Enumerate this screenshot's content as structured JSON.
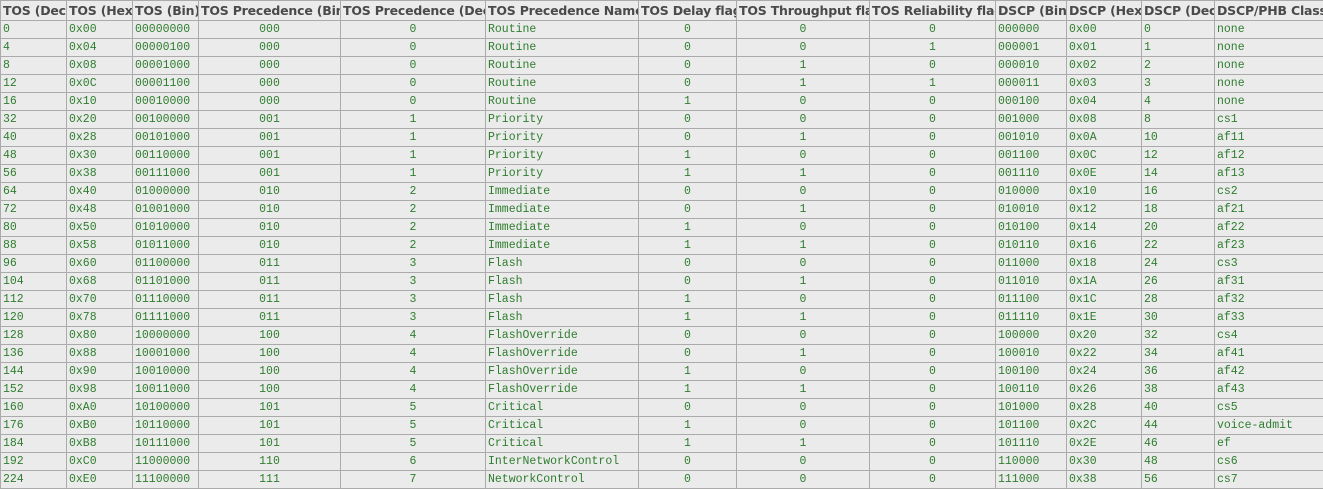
{
  "table": {
    "headers": [
      "TOS (Dec)",
      "TOS (Hex)",
      "TOS (Bin)",
      "TOS Precedence (Bin)",
      "TOS Precedence (Dec)",
      "TOS Precedence Name",
      "TOS Delay flag",
      "TOS Throughput flag",
      "TOS Reliability flag",
      "DSCP (Bin)",
      "DSCP (Hex)",
      "DSCP (Dec)",
      "DSCP/PHB Class"
    ],
    "rows": [
      [
        "0",
        "0x00",
        "00000000",
        "000",
        "0",
        "Routine",
        "0",
        "0",
        "0",
        "000000",
        "0x00",
        "0",
        "none"
      ],
      [
        "4",
        "0x04",
        "00000100",
        "000",
        "0",
        "Routine",
        "0",
        "0",
        "1",
        "000001",
        "0x01",
        "1",
        "none"
      ],
      [
        "8",
        "0x08",
        "00001000",
        "000",
        "0",
        "Routine",
        "0",
        "1",
        "0",
        "000010",
        "0x02",
        "2",
        "none"
      ],
      [
        "12",
        "0x0C",
        "00001100",
        "000",
        "0",
        "Routine",
        "0",
        "1",
        "1",
        "000011",
        "0x03",
        "3",
        "none"
      ],
      [
        "16",
        "0x10",
        "00010000",
        "000",
        "0",
        "Routine",
        "1",
        "0",
        "0",
        "000100",
        "0x04",
        "4",
        "none"
      ],
      [
        "32",
        "0x20",
        "00100000",
        "001",
        "1",
        "Priority",
        "0",
        "0",
        "0",
        "001000",
        "0x08",
        "8",
        "cs1"
      ],
      [
        "40",
        "0x28",
        "00101000",
        "001",
        "1",
        "Priority",
        "0",
        "1",
        "0",
        "001010",
        "0x0A",
        "10",
        "af11"
      ],
      [
        "48",
        "0x30",
        "00110000",
        "001",
        "1",
        "Priority",
        "1",
        "0",
        "0",
        "001100",
        "0x0C",
        "12",
        "af12"
      ],
      [
        "56",
        "0x38",
        "00111000",
        "001",
        "1",
        "Priority",
        "1",
        "1",
        "0",
        "001110",
        "0x0E",
        "14",
        "af13"
      ],
      [
        "64",
        "0x40",
        "01000000",
        "010",
        "2",
        "Immediate",
        "0",
        "0",
        "0",
        "010000",
        "0x10",
        "16",
        "cs2"
      ],
      [
        "72",
        "0x48",
        "01001000",
        "010",
        "2",
        "Immediate",
        "0",
        "1",
        "0",
        "010010",
        "0x12",
        "18",
        "af21"
      ],
      [
        "80",
        "0x50",
        "01010000",
        "010",
        "2",
        "Immediate",
        "1",
        "0",
        "0",
        "010100",
        "0x14",
        "20",
        "af22"
      ],
      [
        "88",
        "0x58",
        "01011000",
        "010",
        "2",
        "Immediate",
        "1",
        "1",
        "0",
        "010110",
        "0x16",
        "22",
        "af23"
      ],
      [
        "96",
        "0x60",
        "01100000",
        "011",
        "3",
        "Flash",
        "0",
        "0",
        "0",
        "011000",
        "0x18",
        "24",
        "cs3"
      ],
      [
        "104",
        "0x68",
        "01101000",
        "011",
        "3",
        "Flash",
        "0",
        "1",
        "0",
        "011010",
        "0x1A",
        "26",
        "af31"
      ],
      [
        "112",
        "0x70",
        "01110000",
        "011",
        "3",
        "Flash",
        "1",
        "0",
        "0",
        "011100",
        "0x1C",
        "28",
        "af32"
      ],
      [
        "120",
        "0x78",
        "01111000",
        "011",
        "3",
        "Flash",
        "1",
        "1",
        "0",
        "011110",
        "0x1E",
        "30",
        "af33"
      ],
      [
        "128",
        "0x80",
        "10000000",
        "100",
        "4",
        "FlashOverride",
        "0",
        "0",
        "0",
        "100000",
        "0x20",
        "32",
        "cs4"
      ],
      [
        "136",
        "0x88",
        "10001000",
        "100",
        "4",
        "FlashOverride",
        "0",
        "1",
        "0",
        "100010",
        "0x22",
        "34",
        "af41"
      ],
      [
        "144",
        "0x90",
        "10010000",
        "100",
        "4",
        "FlashOverride",
        "1",
        "0",
        "0",
        "100100",
        "0x24",
        "36",
        "af42"
      ],
      [
        "152",
        "0x98",
        "10011000",
        "100",
        "4",
        "FlashOverride",
        "1",
        "1",
        "0",
        "100110",
        "0x26",
        "38",
        "af43"
      ],
      [
        "160",
        "0xA0",
        "10100000",
        "101",
        "5",
        "Critical",
        "0",
        "0",
        "0",
        "101000",
        "0x28",
        "40",
        "cs5"
      ],
      [
        "176",
        "0xB0",
        "10110000",
        "101",
        "5",
        "Critical",
        "1",
        "0",
        "0",
        "101100",
        "0x2C",
        "44",
        "voice-admit"
      ],
      [
        "184",
        "0xB8",
        "10111000",
        "101",
        "5",
        "Critical",
        "1",
        "1",
        "0",
        "101110",
        "0x2E",
        "46",
        "ef"
      ],
      [
        "192",
        "0xC0",
        "11000000",
        "110",
        "6",
        "InterNetworkControl",
        "0",
        "0",
        "0",
        "110000",
        "0x30",
        "48",
        "cs6"
      ],
      [
        "224",
        "0xE0",
        "11100000",
        "111",
        "7",
        "NetworkControl",
        "0",
        "0",
        "0",
        "111000",
        "0x38",
        "56",
        "cs7"
      ]
    ]
  }
}
